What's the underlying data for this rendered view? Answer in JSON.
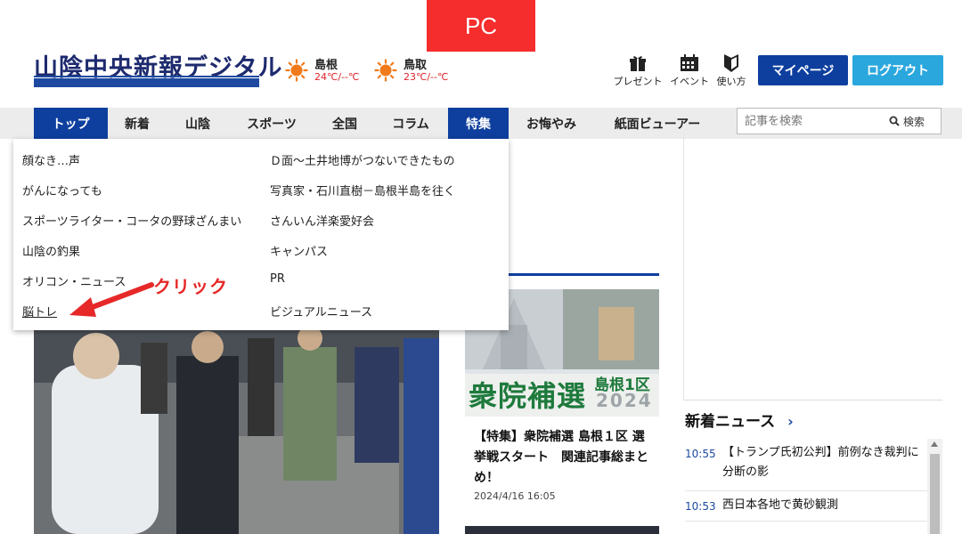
{
  "badge": "PC",
  "logo": "山陰中央新報デジタル",
  "weather": [
    {
      "city": "島根",
      "temp": "24℃/--℃"
    },
    {
      "city": "鳥取",
      "temp": "23℃/--℃"
    }
  ],
  "header_icons": [
    {
      "label": "プレゼント",
      "icon": "gift-icon"
    },
    {
      "label": "イベント",
      "icon": "calendar-icon"
    },
    {
      "label": "使い方",
      "icon": "beginner-mark-icon"
    }
  ],
  "buttons": {
    "mypage": "マイページ",
    "logout": "ログアウト"
  },
  "nav": {
    "items": [
      "トップ",
      "新着",
      "山陰",
      "スポーツ",
      "全国",
      "コラム",
      "特集",
      "お悔やみ",
      "紙面ビューアー"
    ],
    "active": [
      "トップ",
      "特集"
    ]
  },
  "search": {
    "placeholder": "記事を検索",
    "button": "検索"
  },
  "dropdown": {
    "left": [
      "顔なき…声",
      "がんになっても",
      "スポーツライター・コータの野球ざんまい",
      "山陰の釣果",
      "オリコン・ニュース",
      "脳トレ"
    ],
    "right": [
      "Ｄ面～土井地博がつないできたもの",
      "写真家・石川直樹－島根半島を往く",
      "さんいん洋楽愛好会",
      "キャンパス",
      "PR",
      "ビジュアルニュース"
    ]
  },
  "annotation": {
    "text": "クリック",
    "color": "#e62828"
  },
  "article": {
    "title": "【特集】衆院補選 島根１区 選挙戦スタート　関連記事総まとめ！",
    "date": "2024/4/16 16:05",
    "image_text_main": "衆院補選",
    "image_text_sub": "島根1区",
    "image_year": "2024"
  },
  "latest_news": {
    "heading": "新着ニュース",
    "items": [
      {
        "time": "10:55",
        "text": "【トランプ氏初公判】前例なき裁判に分断の影"
      },
      {
        "time": "10:53",
        "text": "西日本各地で黄砂観測"
      }
    ]
  },
  "colors": {
    "brand": "#0e3f9e",
    "logout": "#2aa7dd",
    "badge": "#f52d2d"
  }
}
